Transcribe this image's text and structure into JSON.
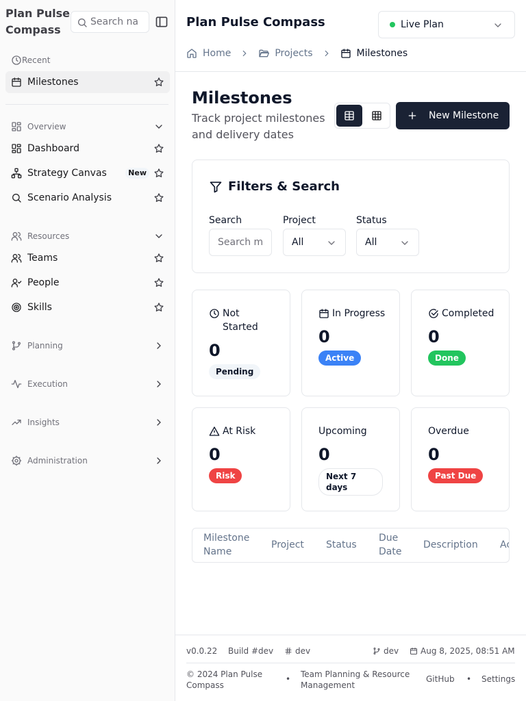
{
  "sidebar": {
    "brand": "Plan Pulse Compass",
    "search_placeholder": "Search na",
    "recent": {
      "label": "Recent",
      "items": [
        {
          "label": "Milestones"
        }
      ]
    },
    "overview": {
      "label": "Overview",
      "items": [
        {
          "label": "Dashboard"
        },
        {
          "label": "Strategy Canvas",
          "badge": "New"
        },
        {
          "label": "Scenario Analysis"
        }
      ]
    },
    "resources": {
      "label": "Resources",
      "items": [
        {
          "label": "Teams"
        },
        {
          "label": "People"
        },
        {
          "label": "Skills"
        }
      ]
    },
    "collapsed_sections": [
      {
        "label": "Planning"
      },
      {
        "label": "Execution"
      },
      {
        "label": "Insights"
      },
      {
        "label": "Administration"
      }
    ]
  },
  "header": {
    "title": "Plan Pulse Compass",
    "plan_select": "Live Plan",
    "breadcrumb": [
      {
        "label": "Home"
      },
      {
        "label": "Projects"
      },
      {
        "label": "Milestones"
      }
    ]
  },
  "page": {
    "title": "Milestones",
    "subtitle": "Track project milestones and delivery dates",
    "new_button": "New Milestone"
  },
  "filters": {
    "title": "Filters & Search",
    "search_label": "Search",
    "search_placeholder": "Search m",
    "project_label": "Project",
    "project_value": "All",
    "status_label": "Status",
    "status_value": "All"
  },
  "stats": [
    {
      "label": "Not Started",
      "value": "0",
      "badge": "Pending"
    },
    {
      "label": "In Progress",
      "value": "0",
      "badge": "Active"
    },
    {
      "label": "Completed",
      "value": "0",
      "badge": "Done"
    },
    {
      "label": "At Risk",
      "value": "0",
      "badge": "Risk"
    },
    {
      "label": "Upcoming",
      "value": "0",
      "badge": "Next 7 days"
    },
    {
      "label": "Overdue",
      "value": "0",
      "badge": "Past Due"
    }
  ],
  "table": {
    "columns": [
      "Milestone Name",
      "Project",
      "Status",
      "Due Date",
      "Description",
      "Ac"
    ]
  },
  "footer": {
    "version": "v0.0.22",
    "build": "Build #dev",
    "env": "dev",
    "branch": "dev",
    "date": "Aug 8, 2025, 08:51 AM",
    "copyright": "© 2024 Plan Pulse Compass",
    "tagline": "Team Planning & Resource Management",
    "github": "GitHub",
    "settings": "Settings",
    "bullet": "•"
  },
  "colors": {
    "primary": "#1a2234",
    "live_dot": "#22c55e",
    "active_blue": "#3b82f6",
    "done_green": "#22c55e",
    "risk_red": "#ef4444"
  }
}
